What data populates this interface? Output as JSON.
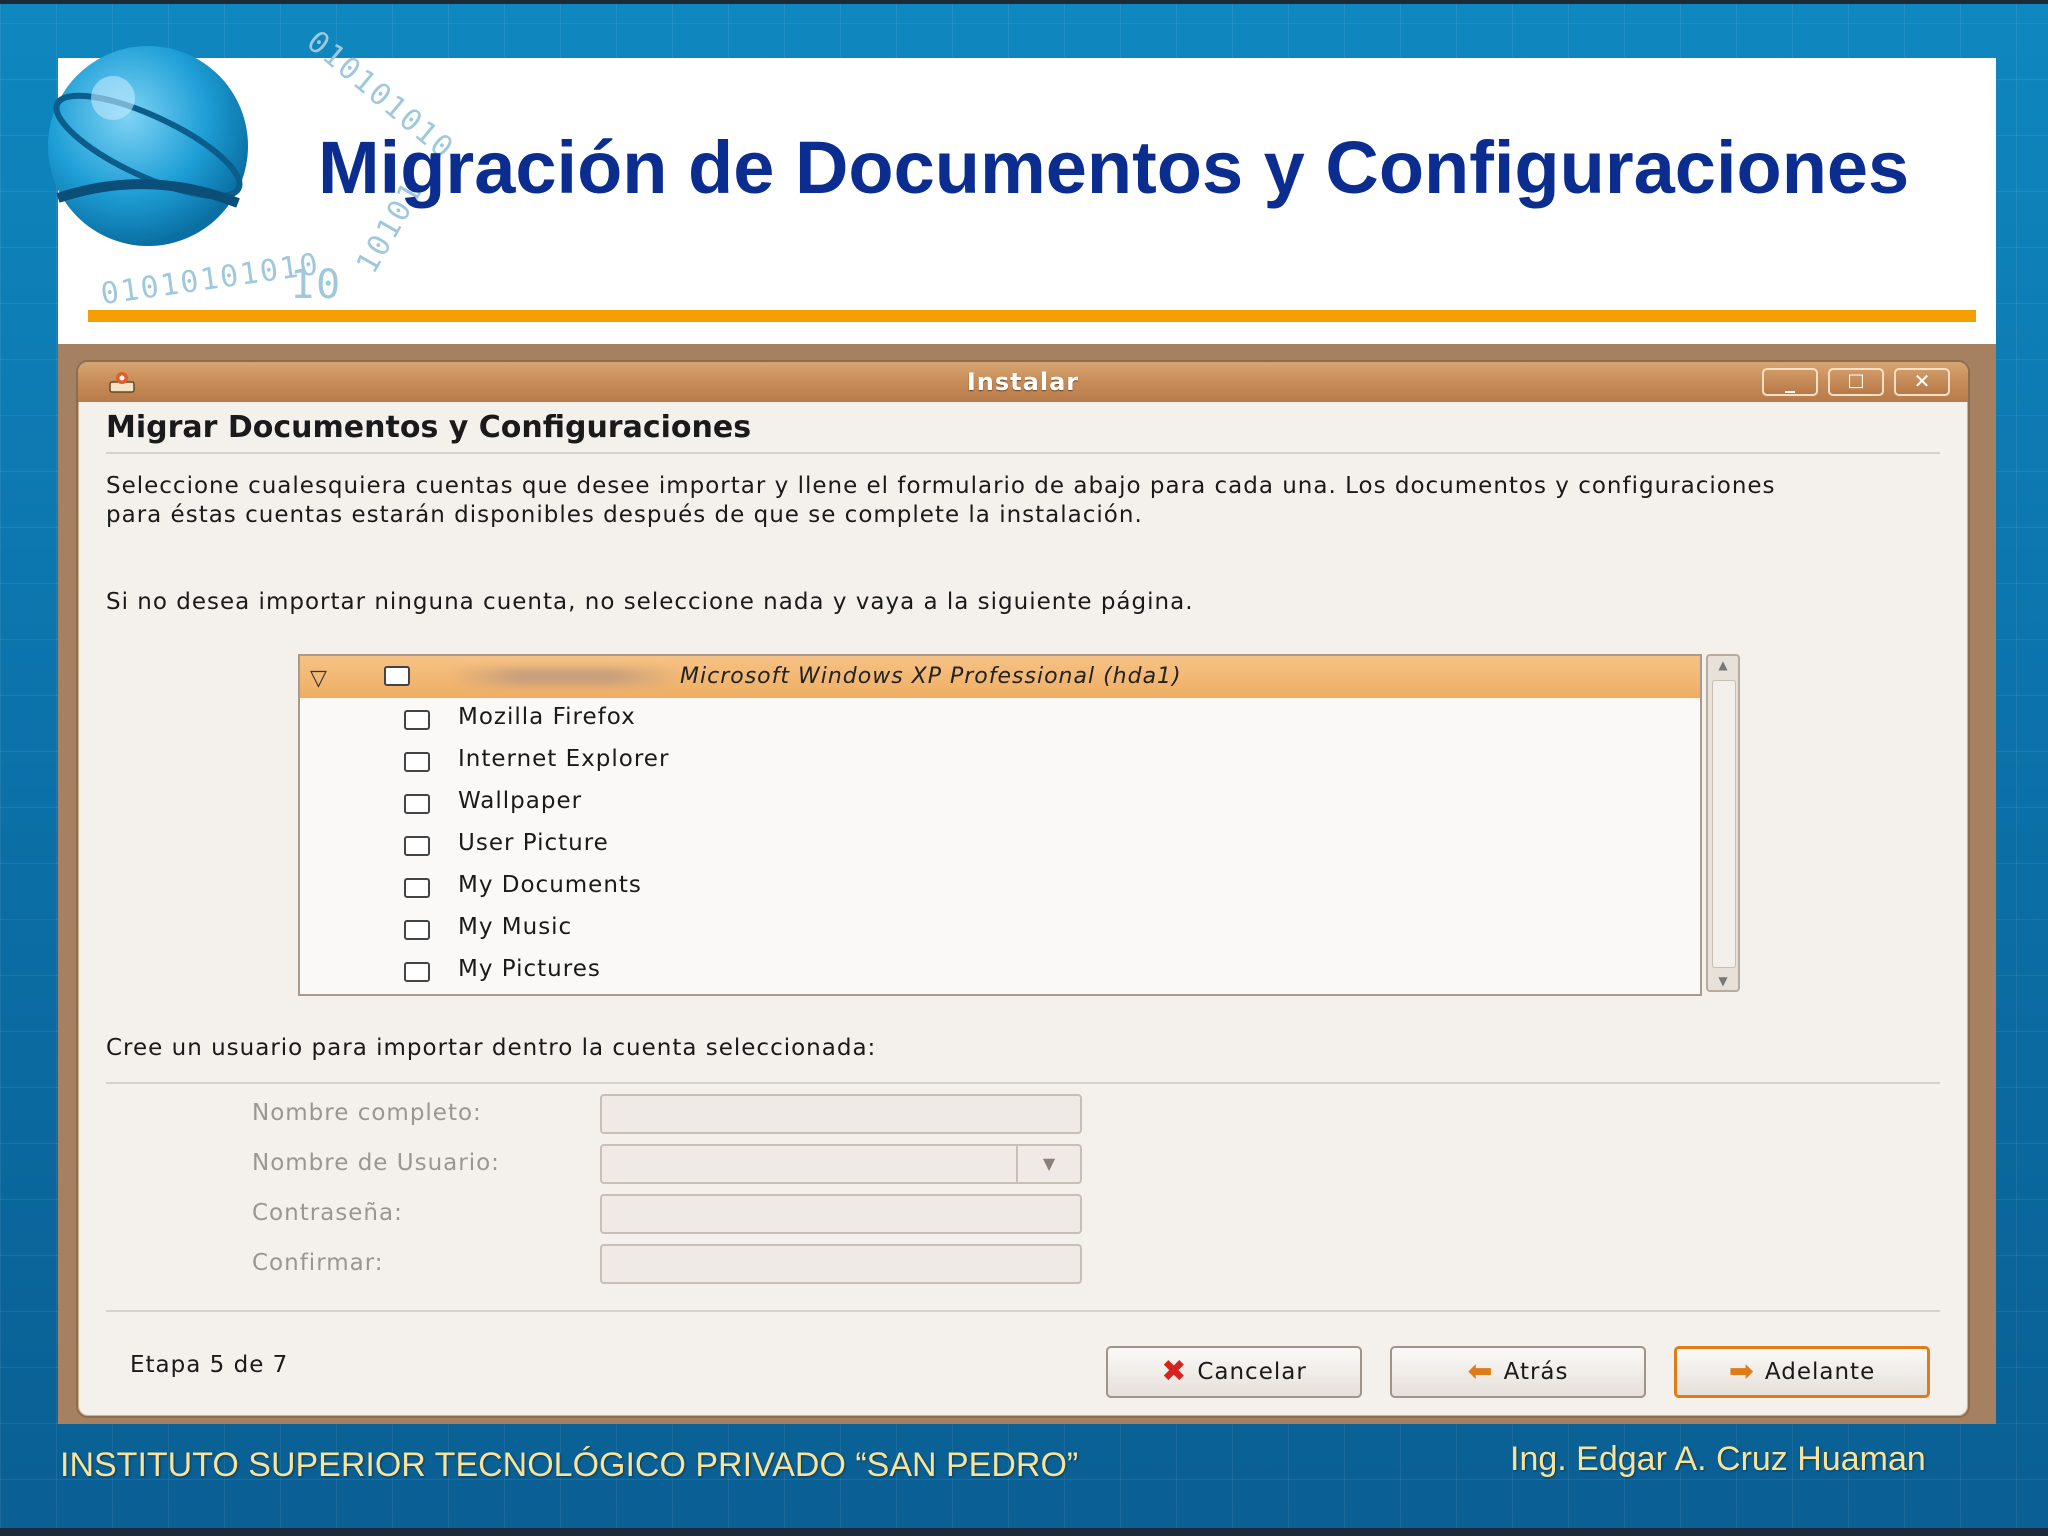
{
  "slide": {
    "title": "Migración de Documentos y Configuraciones",
    "binary_top": "01010101010",
    "binary_left": "010101010",
    "binary_mid": "10",
    "binary_right": "10101",
    "footer_left": "INSTITUTO SUPERIOR TECNOLÓGICO PRIVADO “SAN PEDRO”",
    "footer_right": "Ing. Edgar A. Cruz Huaman"
  },
  "window": {
    "title": "Instalar",
    "controls": {
      "minimize": "_",
      "maximize": "□",
      "close": "✕"
    },
    "page_heading": "Migrar Documentos y Configuraciones",
    "intro_text": "Seleccione cualesquiera cuentas que desee importar y llene el formulario de abajo para cada una. Los documentos y configuraciones para éstas cuentas estarán disponibles después de que se complete la instalación.",
    "skip_text": "Si no desea importar ninguna cuenta, no seleccione nada y vaya a la siguiente página.",
    "tree": {
      "parent_label": "Microsoft Windows XP Professional (hda1)",
      "children": [
        "Mozilla Firefox",
        "Internet Explorer",
        "Wallpaper",
        "User Picture",
        "My Documents",
        "My Music",
        "My Pictures"
      ]
    },
    "create_user_text": "Cree un usuario para importar dentro la cuenta seleccionada:",
    "form": {
      "full_name_label": "Nombre completo:",
      "username_label": "Nombre de Usuario:",
      "password_label": "Contraseña:",
      "confirm_label": "Confirmar:",
      "full_name_value": "",
      "username_value": "",
      "password_value": "",
      "confirm_value": ""
    },
    "step_text": "Etapa 5 de 7",
    "buttons": {
      "cancel": "Cancelar",
      "back": "Atrás",
      "forward": "Adelante"
    },
    "colors": {
      "accent": "#e07b1a",
      "titlebar": "#c68b58",
      "selection": "#f0b064"
    }
  }
}
